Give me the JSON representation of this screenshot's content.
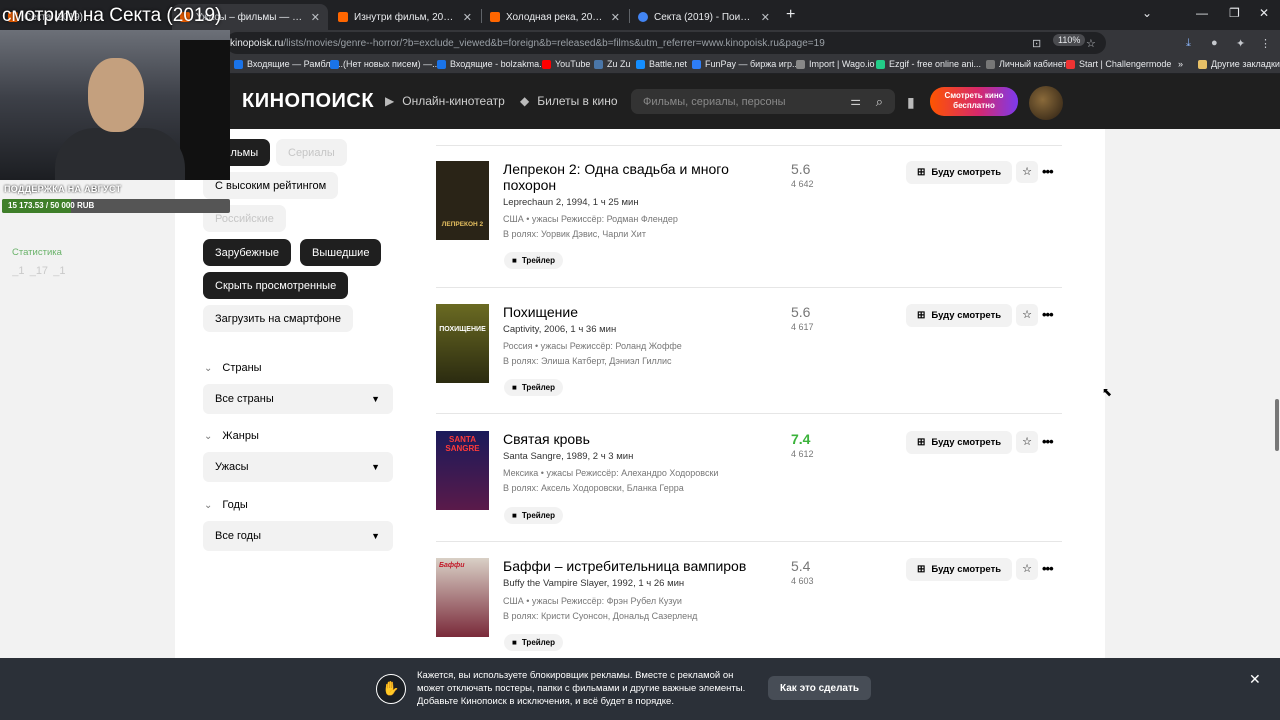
{
  "browser": {
    "tabs": [
      {
        "label": "Секта (2019) — Кинопоиск",
        "color": "#f60"
      },
      {
        "label": "Ужасы – фильмы — Кинопоиск",
        "color": "#f60"
      },
      {
        "label": "Изнутри фильм, 2008, дата вы...",
        "color": "#f60"
      },
      {
        "label": "Холодная река, 2021 — смотр...",
        "color": "#f60"
      },
      {
        "label": "Секта (2019) - Поиск в Google",
        "color": "#4285f4"
      }
    ],
    "url_host": "kinopoisk.ru",
    "url_path": "/lists/movies/genre--horror/?b=exclude_viewed&b=foreign&b=released&b=films&utm_referrer=www.kinopoisk.ru&page=19",
    "zoom": "110%",
    "bookmarks": [
      {
        "label": "Входящие — Рамбле...",
        "color": "#1a73e8"
      },
      {
        "label": "(Нет новых писем) —...",
        "color": "#1a73e8"
      },
      {
        "label": "Входящие - bolzakma...",
        "color": "#1a73e8"
      },
      {
        "label": "YouTube",
        "color": "#f00"
      },
      {
        "label": "Zu Zu",
        "color": "#4a76a8"
      },
      {
        "label": "Battle.net",
        "color": "#148eff"
      },
      {
        "label": "FunPay — биржа игр...",
        "color": "#2e7df6"
      },
      {
        "label": "Import | Wago.io",
        "color": "#888"
      },
      {
        "label": "Ezgif - free online ani...",
        "color": "#2c8"
      },
      {
        "label": "Личный кабинет",
        "color": "#777"
      },
      {
        "label": "Start | Challengermode",
        "color": "#e33"
      }
    ],
    "other_bookmarks": "Другие закладки"
  },
  "header": {
    "logo": "КИНОПОИСК",
    "online": "Онлайн-кинотеатр",
    "tickets": "Билеты в кино",
    "search_placeholder": "Фильмы, сериалы, персоны",
    "watch_free": "Смотреть кино бесплатно"
  },
  "filters": {
    "chips": [
      "Фильмы",
      "Сериалы",
      "С высоким рейтингом",
      "Российские",
      "Зарубежные",
      "Вышедшие",
      "Скрыть просмотренные",
      "Загрузить на смартфоне"
    ],
    "countries_label": "Страны",
    "countries_value": "Все страны",
    "genres_label": "Жанры",
    "genres_value": "Ужасы",
    "years_label": "Годы",
    "years_value": "Все годы"
  },
  "movies": [
    {
      "title": "Лепрекон 2: Одна свадьба и много похорон",
      "subtitle": "Leprechaun 2, 1994, 1 ч 25 мин",
      "meta": "США • ужасы   Режиссёр: Родман Флендер",
      "cast": "В ролях: Уорвик Дэвис, Чарли Хит",
      "rating": "5.6",
      "votes": "4 642",
      "poster_text": "ЛЕПРЕКОН 2",
      "poster_bg": "#2a2417"
    },
    {
      "title": "Похищение",
      "subtitle": "Captivity, 2006, 1 ч 36 мин",
      "meta": "Россия • ужасы   Режиссёр: Роланд Жоффе",
      "cast": "В ролях: Элиша Катберт, Дэниэл Гиллис",
      "rating": "5.6",
      "votes": "4 617",
      "poster_text": "ПОХИЩЕНИЕ",
      "poster_bg": "#5a5a1e"
    },
    {
      "title": "Святая кровь",
      "subtitle": "Santa Sangre, 1989, 2 ч 3 мин",
      "meta": "Мексика • ужасы   Режиссёр: Алехандро Ходоровски",
      "cast": "В ролях: Аксель Ходоровски, Бланка Герра",
      "rating": "7.4",
      "votes": "4 612",
      "poster_text": "SANTA SANGRE",
      "poster_bg": "#3a1a3a"
    },
    {
      "title": "Баффи – истребительница вампиров",
      "subtitle": "Buffy the Vampire Slayer, 1992, 1 ч 26 мин",
      "meta": "США • ужасы   Режиссёр: Фрэн Рубел Кузуи",
      "cast": "В ролях: Кристи Суонсон, Дональд Сазерленд",
      "rating": "5.4",
      "votes": "4 603",
      "poster_text": "Баффи",
      "poster_bg": "#7a2a3a"
    }
  ],
  "labels": {
    "trailer": "Трейлер",
    "will_watch": "Буду смотреть"
  },
  "adblock": {
    "text": "Кажется, вы используете блокировщик рекламы. Вместе с рекламой он может отключать постеры, папки с фильмами и другие важные элементы. Добавьте Кинопоиск в исключения, и всё будет в порядке.",
    "button": "Как это сделать"
  },
  "stream": {
    "title": "смотрим на Секта (2019)",
    "support": "ПОДДЕРЖКА НА АВГУСТ",
    "goal_text": "15 173.53 / 50 000 RUB",
    "goal_fraction": 0.3035,
    "stats_label": "Статистика",
    "stat_values": " _1   _17   _1"
  }
}
